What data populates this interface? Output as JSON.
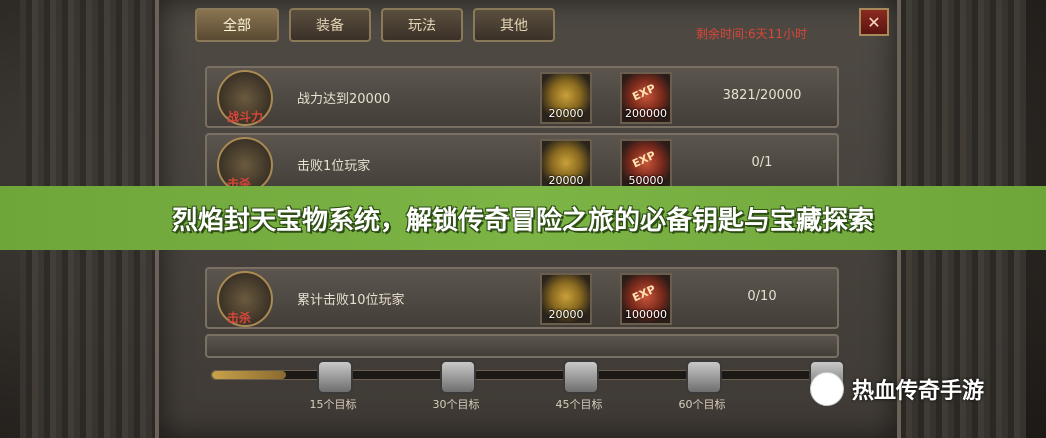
{
  "tabs": [
    "全部",
    "装备",
    "玩法",
    "其他"
  ],
  "timer": "剩余时间:6天11小时",
  "close_glyph": "✕",
  "rows": [
    {
      "badge": "战斗力",
      "task": "战力达到20000",
      "gold": "20000",
      "exp_tag": "EXP",
      "exp": "200000",
      "progress": "3821/20000"
    },
    {
      "badge": "击杀",
      "task": "击败1位玩家",
      "gold": "20000",
      "exp_tag": "EXP",
      "exp": "50000",
      "progress": "0/1"
    },
    {
      "badge": "击杀",
      "task": "累计击败10位玩家",
      "gold": "20000",
      "exp_tag": "EXP",
      "exp": "100000",
      "progress": "0/10"
    }
  ],
  "milestones": [
    "15个目标",
    "30个目标",
    "45个目标",
    "60个目标",
    "7"
  ],
  "milestone_progress": 0.12,
  "banner_title": "烈焰封天宝物系统，解锁传奇冒险之旅的必备钥匙与宝藏探索",
  "watermark": "热血传奇手游",
  "colors": {
    "banner": "#7cb446",
    "timer": "#d9463a",
    "gold_text": "#e4d6b4"
  }
}
